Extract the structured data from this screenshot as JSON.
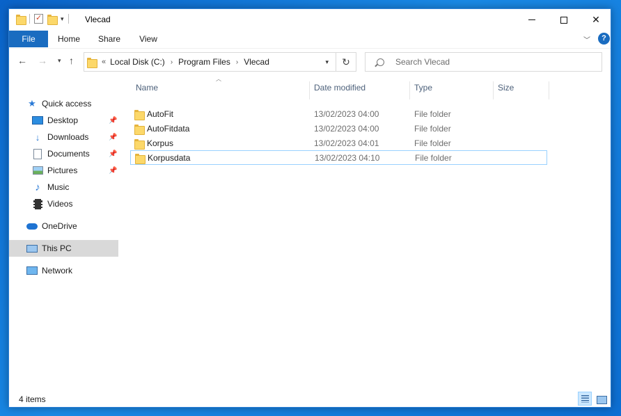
{
  "window": {
    "title": "Vlecad"
  },
  "ribbon": {
    "tabs": [
      "File",
      "Home",
      "Share",
      "View"
    ],
    "help": "?"
  },
  "address": {
    "crumbs": [
      "Local Disk (C:)",
      "Program Files",
      "Vlecad"
    ],
    "lead": "«"
  },
  "search": {
    "placeholder": "Search Vlecad"
  },
  "sidebar": {
    "items": [
      {
        "label": "Quick access",
        "icon": "star-icon"
      },
      {
        "label": "Desktop",
        "icon": "desktop-icon",
        "pinned": true
      },
      {
        "label": "Downloads",
        "icon": "download-icon",
        "pinned": true
      },
      {
        "label": "Documents",
        "icon": "document-icon",
        "pinned": true
      },
      {
        "label": "Pictures",
        "icon": "picture-icon",
        "pinned": true
      },
      {
        "label": "Music",
        "icon": "music-icon"
      },
      {
        "label": "Videos",
        "icon": "video-icon"
      },
      {
        "label": "OneDrive",
        "icon": "cloud-icon"
      },
      {
        "label": "This PC",
        "icon": "computer-icon",
        "selected": true
      },
      {
        "label": "Network",
        "icon": "network-icon"
      }
    ]
  },
  "columns": {
    "name": "Name",
    "date": "Date modified",
    "type": "Type",
    "size": "Size"
  },
  "files": [
    {
      "name": "AutoFit",
      "date": "13/02/2023 04:00",
      "type": "File folder"
    },
    {
      "name": "AutoFitdata",
      "date": "13/02/2023 04:00",
      "type": "File folder"
    },
    {
      "name": "Korpus",
      "date": "13/02/2023 04:01",
      "type": "File folder"
    },
    {
      "name": "Korpusdata",
      "date": "13/02/2023 04:10",
      "type": "File folder"
    }
  ],
  "status": {
    "count": "4 items"
  },
  "colors": {
    "accent": "#1a6cc0",
    "selection": "#cce8ff",
    "folder": "#fcd86a"
  }
}
